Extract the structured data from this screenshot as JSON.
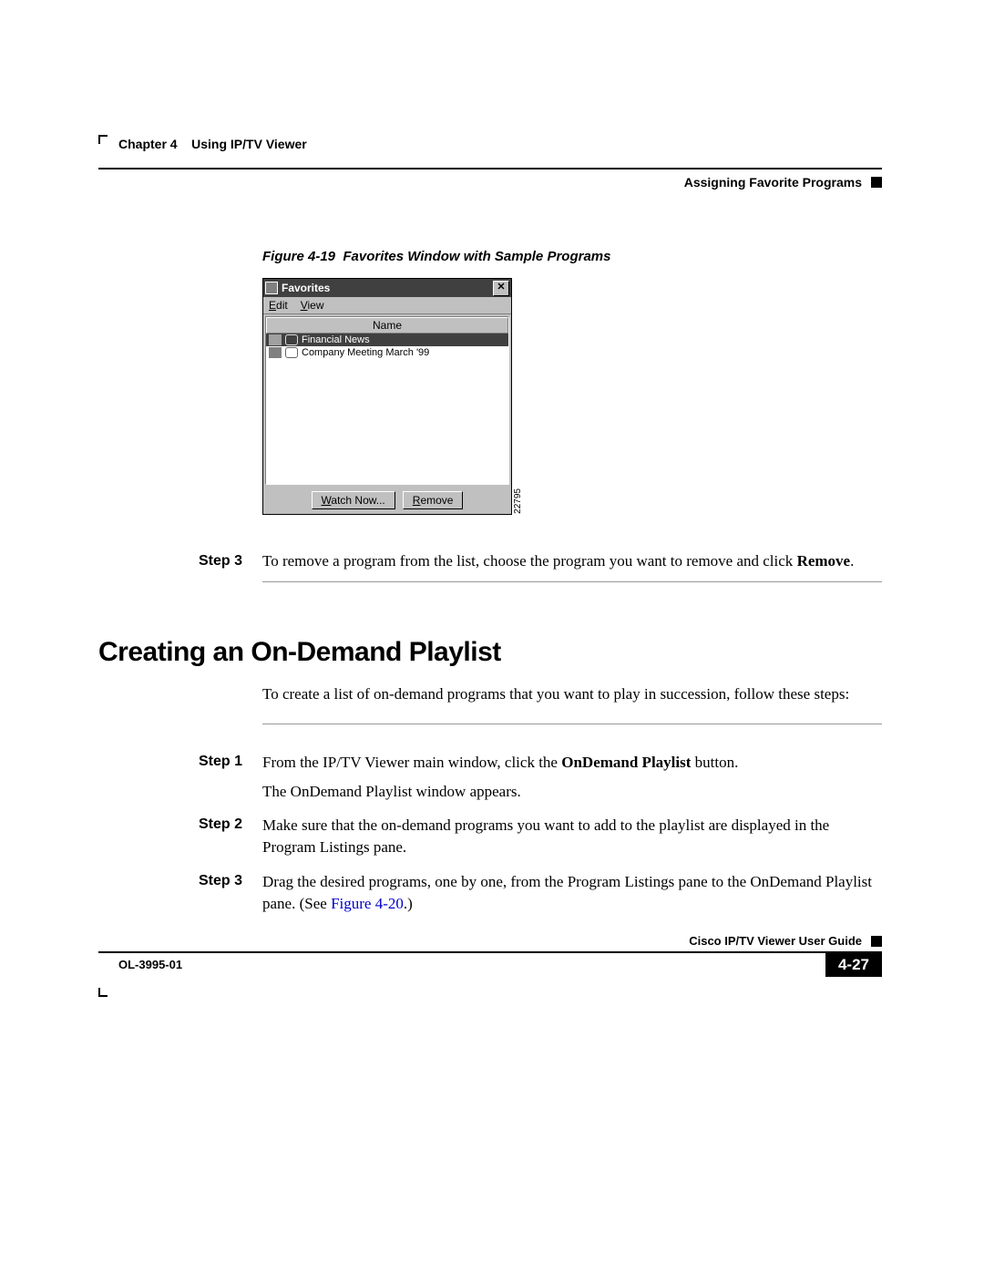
{
  "header": {
    "chapter_label": "Chapter 4",
    "chapter_title": "Using IP/TV Viewer",
    "section_title": "Assigning Favorite Programs"
  },
  "figure": {
    "number": "Figure 4-19",
    "caption": "Favorites Window with Sample Programs",
    "code": "22795"
  },
  "fav_window": {
    "title": "Favorites",
    "close": "✕",
    "menu_edit": "Edit",
    "menu_view": "View",
    "col_name": "Name",
    "rows": [
      {
        "text": "Financial News"
      },
      {
        "text": "Company Meeting March '99"
      }
    ],
    "btn_watch": "Watch Now...",
    "btn_remove": "Remove"
  },
  "step3_top": {
    "label": "Step 3",
    "text_a": "To remove a program from the list, choose the program you want to remove and click ",
    "text_b": "Remove",
    "text_c": "."
  },
  "h2": "Creating an On-Demand Playlist",
  "intro": "To create a list of on-demand programs that you want to play in succession, follow these steps:",
  "steps": [
    {
      "label": "Step 1",
      "parts": [
        {
          "t": "From the IP/TV Viewer main window, click the "
        },
        {
          "t": "OnDemand Playlist",
          "bold": true
        },
        {
          "t": " button."
        }
      ],
      "sub": "The OnDemand Playlist window appears."
    },
    {
      "label": "Step 2",
      "parts": [
        {
          "t": "Make sure that the on-demand programs you want to add to the playlist are displayed in the Program Listings pane."
        }
      ]
    },
    {
      "label": "Step 3",
      "parts": [
        {
          "t": "Drag the desired programs, one by one, from the Program Listings pane to the OnDemand Playlist pane. (See "
        },
        {
          "t": "Figure 4-20",
          "link": true
        },
        {
          "t": ".)"
        }
      ]
    }
  ],
  "footer": {
    "guide": "Cisco IP/TV Viewer User Guide",
    "doc_id": "OL-3995-01",
    "page": "4-27"
  }
}
